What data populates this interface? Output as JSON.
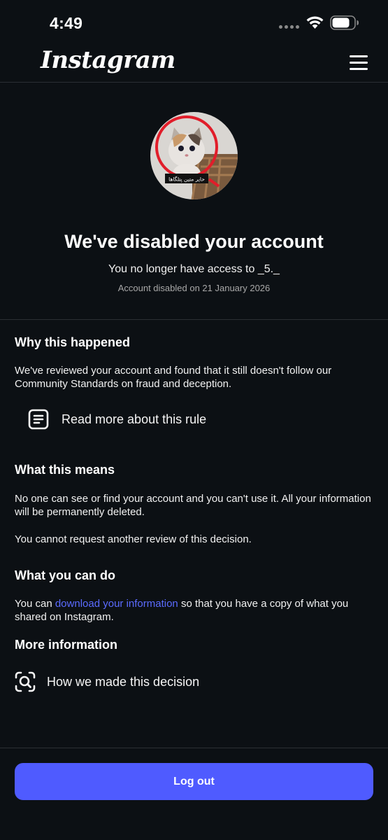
{
  "status_bar": {
    "time": "4:49"
  },
  "header": {
    "brand": "Instagram",
    "menu_icon": "hamburger-menu-icon"
  },
  "profile": {
    "avatar_caption": "حایر متین پتلگاها",
    "title": "We've disabled your account",
    "access_text": "You no longer have access to _5._",
    "disabled_date": "Account disabled on 21 January 2026"
  },
  "why": {
    "heading": "Why this happened",
    "body": "We've reviewed your account and found that it still doesn't follow our Community Standards on fraud and deception.",
    "rule_link": "Read more about this rule",
    "rule_icon": "document-icon"
  },
  "means": {
    "heading": "What this means",
    "body_1": "No one can see or find your account and you can't use it. All your information will be permanently deleted.",
    "body_2": "You cannot request another review of this decision."
  },
  "can_do": {
    "heading": "What you can do",
    "prefix": "You can ",
    "link": "download your information",
    "suffix": " so that you have a copy of what you shared on Instagram."
  },
  "more_info": {
    "heading": "More information",
    "decision_link": "How we made this decision",
    "decision_icon": "search-document-icon"
  },
  "footer": {
    "logout_label": "Log out",
    "button_color": "#4f5bff"
  },
  "colors": {
    "background": "#0c1014",
    "link": "#5b6bff",
    "divider": "#2b2f34"
  }
}
